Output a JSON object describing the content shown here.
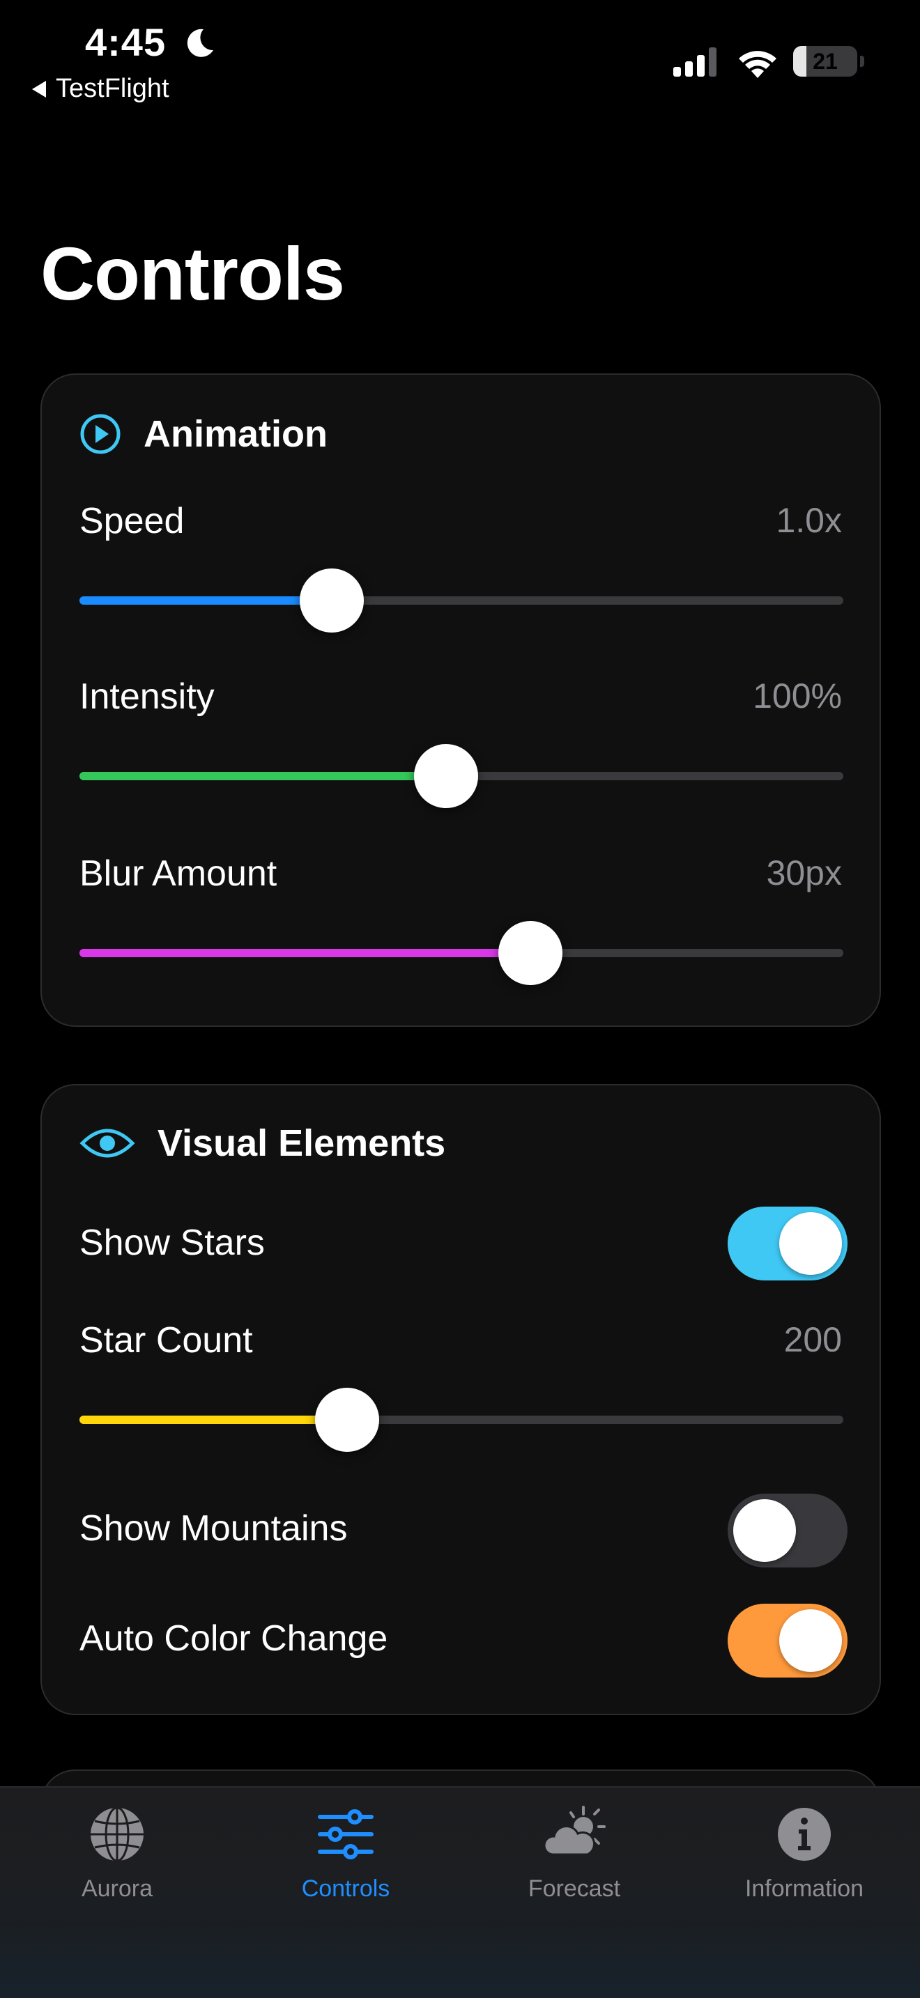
{
  "status_bar": {
    "time": "4:45",
    "back_app": "TestFlight",
    "battery": "21"
  },
  "page": {
    "title": "Controls"
  },
  "animation": {
    "title": "Animation",
    "speed": {
      "label": "Speed",
      "value": "1.0x",
      "fraction": 0.33,
      "color": "#1a8cff"
    },
    "intensity": {
      "label": "Intensity",
      "value": "100%",
      "fraction": 0.48,
      "color": "#34c759"
    },
    "blur": {
      "label": "Blur Amount",
      "value": "30px",
      "fraction": 0.59,
      "color": "#d838e8"
    }
  },
  "visual": {
    "title": "Visual Elements",
    "show_stars": {
      "label": "Show Stars",
      "on": true,
      "color": "#40c8f4"
    },
    "star_count": {
      "label": "Star Count",
      "value": "200",
      "fraction": 0.35,
      "color": "#ffd60a"
    },
    "show_mountains": {
      "label": "Show Mountains",
      "on": false,
      "color": "#39393d"
    },
    "auto_color": {
      "label": "Auto Color Change",
      "on": true,
      "color": "#ff9a3c"
    }
  },
  "tabs": [
    {
      "label": "Aurora",
      "icon": "globe-icon",
      "active": false
    },
    {
      "label": "Controls",
      "icon": "sliders-icon",
      "active": true
    },
    {
      "label": "Forecast",
      "icon": "cloud-sun-icon",
      "active": false
    },
    {
      "label": "Information",
      "icon": "info-icon",
      "active": false
    }
  ],
  "colors": {
    "accent": "#1f8fff",
    "header_icon": "#40c8f4",
    "inactive": "#8e8e93"
  }
}
